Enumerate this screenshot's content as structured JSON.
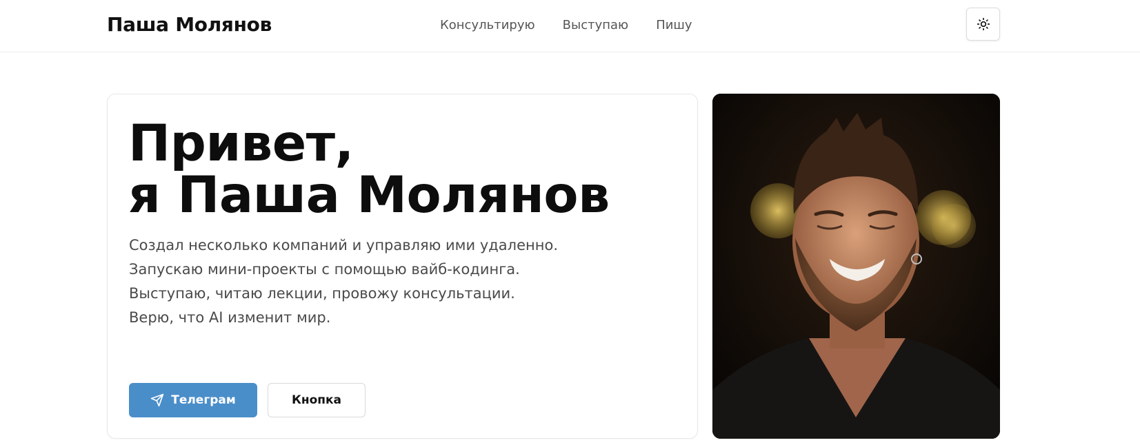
{
  "header": {
    "logo": "Паша Молянов",
    "nav": [
      "Консультирую",
      "Выступаю",
      "Пишу"
    ],
    "theme_icon": "sun-icon"
  },
  "hero": {
    "title_line1": "Привет,",
    "title_line2": "я Паша Молянов",
    "paragraphs": [
      "Создал несколько компаний и управляю ими удаленно.",
      "Запускаю мини-проекты с помощью вайб-кодинга.",
      "Выступаю, читаю лекции, провожу консультации.",
      "Верю, что AI изменит мир."
    ],
    "primary_button": "Телеграм",
    "primary_icon": "paper-plane-icon",
    "secondary_button": "Кнопка"
  },
  "colors": {
    "accent": "#4a8ec9",
    "text": "#111111",
    "muted_text": "#4a4a4a",
    "border": "#e8e8e8"
  }
}
